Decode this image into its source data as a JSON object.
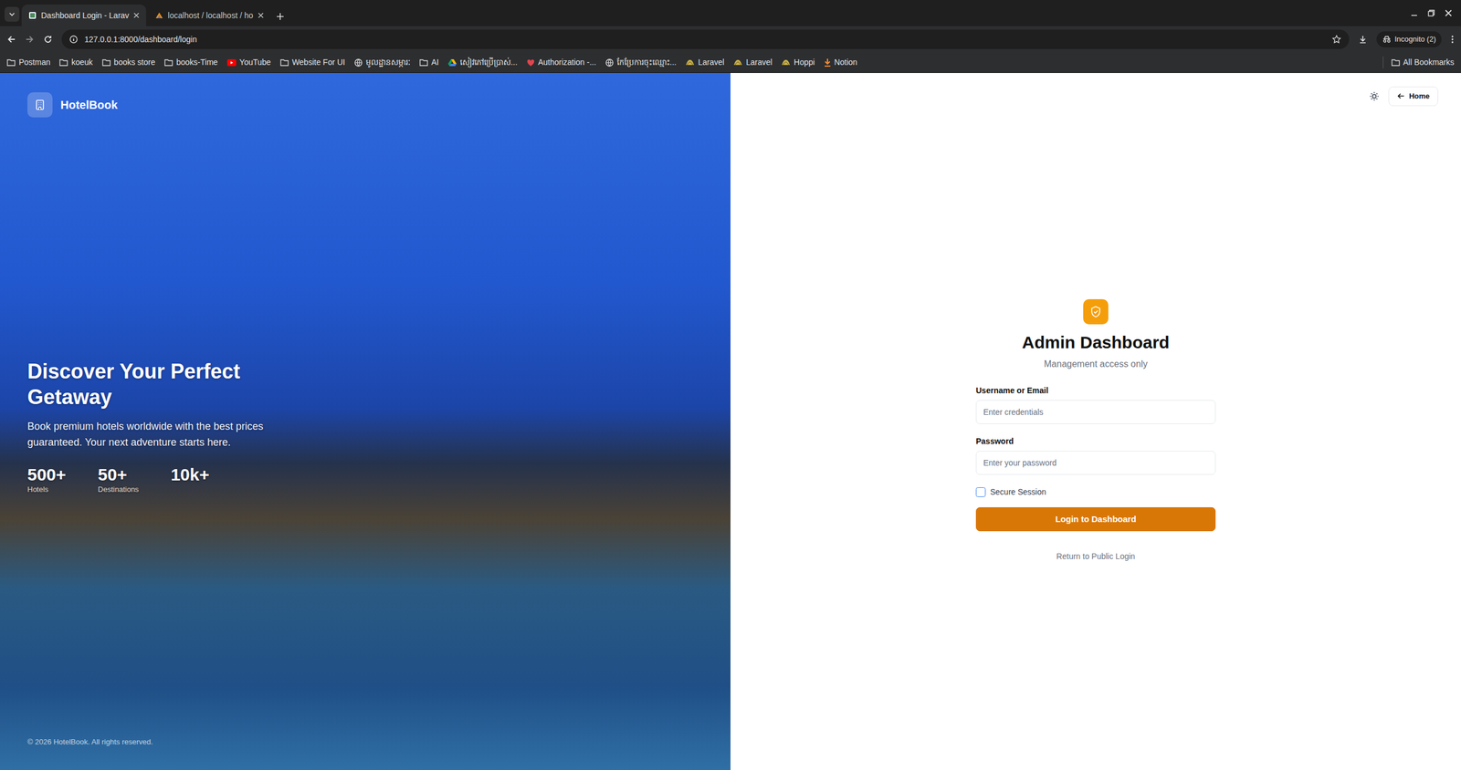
{
  "browser": {
    "tabs": [
      {
        "label": "Dashboard Login - Larav",
        "selected": true
      },
      {
        "label": "localhost / localhost / ho",
        "selected": false
      }
    ],
    "address": "127.0.0.1:8000/dashboard/login",
    "profile": "Incognito (2)",
    "bookmarks": [
      {
        "label": "Postman",
        "kind": "folder"
      },
      {
        "label": "koeuk",
        "kind": "folder"
      },
      {
        "label": "books store",
        "kind": "folder"
      },
      {
        "label": "books-Time",
        "kind": "folder"
      },
      {
        "label": "YouTube",
        "kind": "youtube"
      },
      {
        "label": "Website For UI",
        "kind": "folder"
      },
      {
        "label": "មូលដ្ឋានសម្ភារៈ",
        "kind": "globe"
      },
      {
        "label": "AI",
        "kind": "folder"
      },
      {
        "label": "សៀវភៅប្រើប្រាស់...",
        "kind": "drive"
      },
      {
        "label": "Authorization -...",
        "kind": "auth"
      },
      {
        "label": "កែប្រែការចុះឈ្មោះ...",
        "kind": "globe"
      },
      {
        "label": "Laravel",
        "kind": "laravel"
      },
      {
        "label": "Laravel",
        "kind": "laravel"
      },
      {
        "label": "Hoppi",
        "kind": "laravel"
      },
      {
        "label": "Notion",
        "kind": "notion"
      }
    ],
    "all_bookmarks": "All Bookmarks"
  },
  "page": {
    "brand": "HotelBook",
    "hero": {
      "title": "Discover Your Perfect Getaway",
      "text": "Book premium hotels worldwide with the best prices guaranteed. Your next adventure starts here.",
      "stats": [
        {
          "value": "500+",
          "label": "Hotels"
        },
        {
          "value": "50+",
          "label": "Destinations"
        },
        {
          "value": "10k+"
        }
      ]
    },
    "copyright": "© 2026 HotelBook. All rights reserved.",
    "home_button": "Home",
    "login": {
      "title": "Admin Dashboard",
      "subtitle": "Management access only",
      "fields": [
        {
          "label": "Username or Email",
          "placeholder": "Enter credentials",
          "kind": "text"
        },
        {
          "label": "Password",
          "placeholder": "Enter your password",
          "kind": "password"
        }
      ],
      "remember": {
        "label": "Secure Session",
        "checked": false
      },
      "submit": "Login to Dashboard",
      "link": "Return to Public Login"
    }
  }
}
